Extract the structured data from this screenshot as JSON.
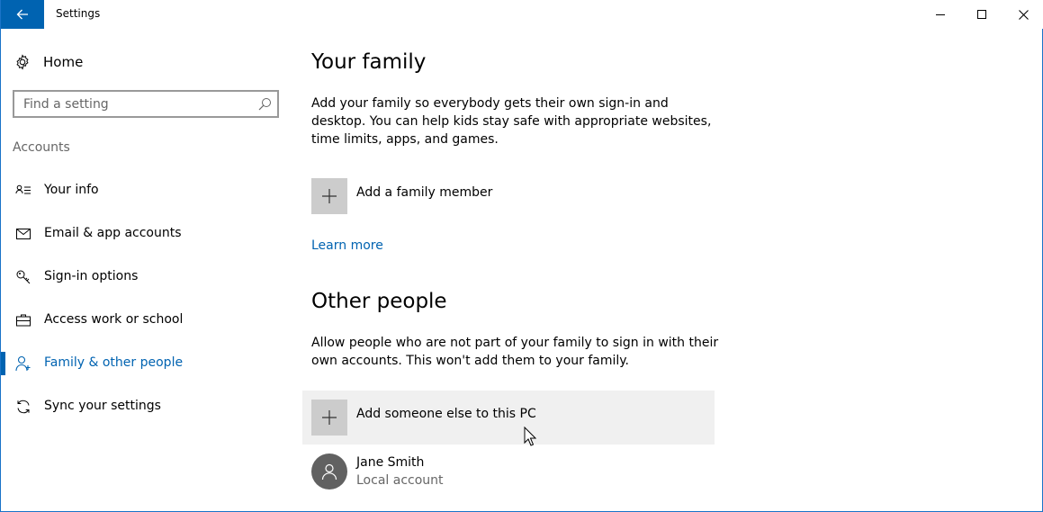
{
  "window": {
    "title": "Settings",
    "accent_color": "#0063b1"
  },
  "sidebar": {
    "home_label": "Home",
    "search_placeholder": "Find a setting",
    "section_label": "Accounts",
    "items": [
      {
        "label": "Your info",
        "icon": "contact-card-icon",
        "active": false
      },
      {
        "label": "Email & app accounts",
        "icon": "mail-icon",
        "active": false
      },
      {
        "label": "Sign-in options",
        "icon": "key-icon",
        "active": false
      },
      {
        "label": "Access work or school",
        "icon": "briefcase-icon",
        "active": false
      },
      {
        "label": "Family & other people",
        "icon": "person-icon",
        "active": true
      },
      {
        "label": "Sync your settings",
        "icon": "sync-icon",
        "active": false
      }
    ]
  },
  "main": {
    "family": {
      "heading": "Your family",
      "description": "Add your family so everybody gets their own sign-in and desktop. You can help kids stay safe with appropriate websites, time limits, apps, and games.",
      "add_label": "Add a family member",
      "learn_more": "Learn more"
    },
    "other": {
      "heading": "Other people",
      "description": "Allow people who are not part of your family to sign in with their own accounts. This won't add them to your family.",
      "add_label": "Add someone else to this PC",
      "people": [
        {
          "name": "Jane Smith",
          "account_type": "Local account"
        }
      ]
    }
  }
}
